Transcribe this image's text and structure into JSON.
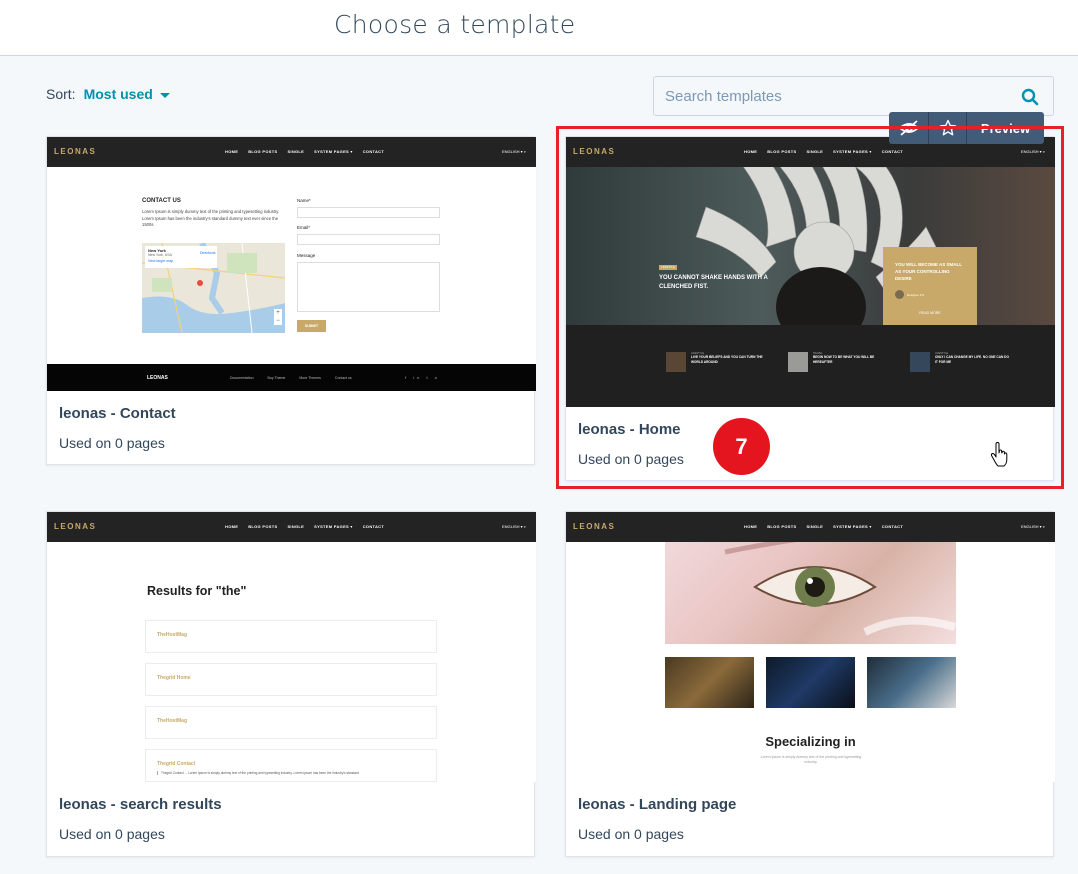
{
  "header": {
    "title": "Choose a template"
  },
  "sort": {
    "label": "Sort:",
    "value": "Most used"
  },
  "search": {
    "placeholder": "Search templates"
  },
  "hover_actions": {
    "preview_label": "Preview"
  },
  "badge": {
    "number": "7"
  },
  "preview_nav": {
    "logo": "LEONAS",
    "links": [
      "HOME",
      "BLOG POSTS",
      "SINGLE",
      "SYSTEM PAGES ▾",
      "CONTACT"
    ],
    "lang": "ENGLISH ▾  ⌕"
  },
  "cards": [
    {
      "name": "leonas - Contact",
      "usage": "Used on 0 pages",
      "preview": {
        "heading": "CONTACT US",
        "body": "Lorem Ipsum is simply dummy text of the printing and typesetting industry. Lorem Ipsum has been the industry's standard dummy text ever since the 1500s",
        "map_place": "New York",
        "map_sub": "New York, USA",
        "map_link": "View larger map",
        "map_dir": "Directions",
        "field_name": "Name*",
        "field_email": "Email*",
        "field_message": "Message",
        "submit": "SUBMIT",
        "footer_logo": "LEONAS",
        "footer_links": [
          "Documentation",
          "Buy Theme",
          "More Themes",
          "Contact us"
        ]
      }
    },
    {
      "name": "leonas - Home",
      "usage": "Used on 0 pages",
      "preview": {
        "tag": "LIFESTYLE",
        "hero_title": "YOU CANNOT SHAKE HANDS WITH A CLENCHED FIST.",
        "box_title": "YOU WILL BECOME AS SMALL AS YOUR CONTROLLING DESIRE",
        "box_author": "Designer F.S",
        "box_read": "READ MORE",
        "posts": [
          {
            "cat": "LIFESTYLE",
            "title": "LIVE YOUR BELIEFS AND YOU CAN TURN THE WORLD AROUND"
          },
          {
            "cat": "TRAVEL",
            "title": "BEGIN NOW TO BE WHAT YOU WILL BE HEREAFTER"
          },
          {
            "cat": "LIFESTYLE",
            "title": "ONLY I CAN CHANGE MY LIFE. NO ONE CAN DO IT FOR ME"
          }
        ]
      }
    },
    {
      "name": "leonas - search results",
      "usage": "Used on 0 pages",
      "preview": {
        "heading": "Results for \"the\"",
        "results": [
          "TheHostMag",
          "Thegrid Home",
          "TheHostMag",
          "Thegrid Contact"
        ],
        "snippet": "Thegrid Contact ... Lorem Ipsum is simply dummy text of the printing and typesetting industry. Lorem Ipsum has been the industry's standard"
      }
    },
    {
      "name": "leonas - Landing page",
      "usage": "Used on 0 pages",
      "preview": {
        "heading": "Specializing in",
        "sub": "Lorem Ipsum is simply dummy text of the printing and typesetting industry."
      }
    }
  ]
}
